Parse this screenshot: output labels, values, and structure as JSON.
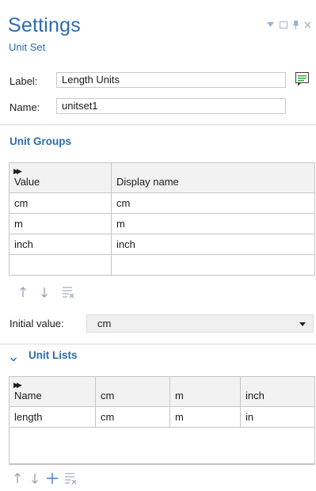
{
  "header": {
    "title": "Settings",
    "subtitle": "Unit Set"
  },
  "window_controls": [
    "dropdown-icon",
    "maximize-icon",
    "pin-icon",
    "close-icon"
  ],
  "form": {
    "label_caption": "Label:",
    "label_value": "Length Units",
    "name_caption": "Name:",
    "name_value": "unitset1"
  },
  "unit_groups": {
    "title": "Unit Groups",
    "columns": [
      "Value",
      "Display name"
    ],
    "rows": [
      [
        "cm",
        "cm"
      ],
      [
        "m",
        "m"
      ],
      [
        "inch",
        "inch"
      ],
      [
        "",
        ""
      ]
    ],
    "toolbar_icons": [
      "move-up-icon",
      "move-down-icon",
      "clear-table-icon"
    ],
    "initial_value_caption": "Initial value:",
    "initial_value": "cm"
  },
  "unit_lists": {
    "title": "Unit Lists",
    "columns": [
      "Name",
      "cm",
      "m",
      "inch"
    ],
    "rows": [
      [
        "length",
        "cm",
        "m",
        "in"
      ]
    ],
    "toolbar_icons": [
      "move-up-icon",
      "move-down-icon",
      "add-icon",
      "clear-table-icon"
    ]
  },
  "colors": {
    "accent": "#2c6cb0",
    "header_bg": "#f2f2f2",
    "grid_border": "#c4c4c4",
    "icon_gray": "#8a9aaa"
  }
}
